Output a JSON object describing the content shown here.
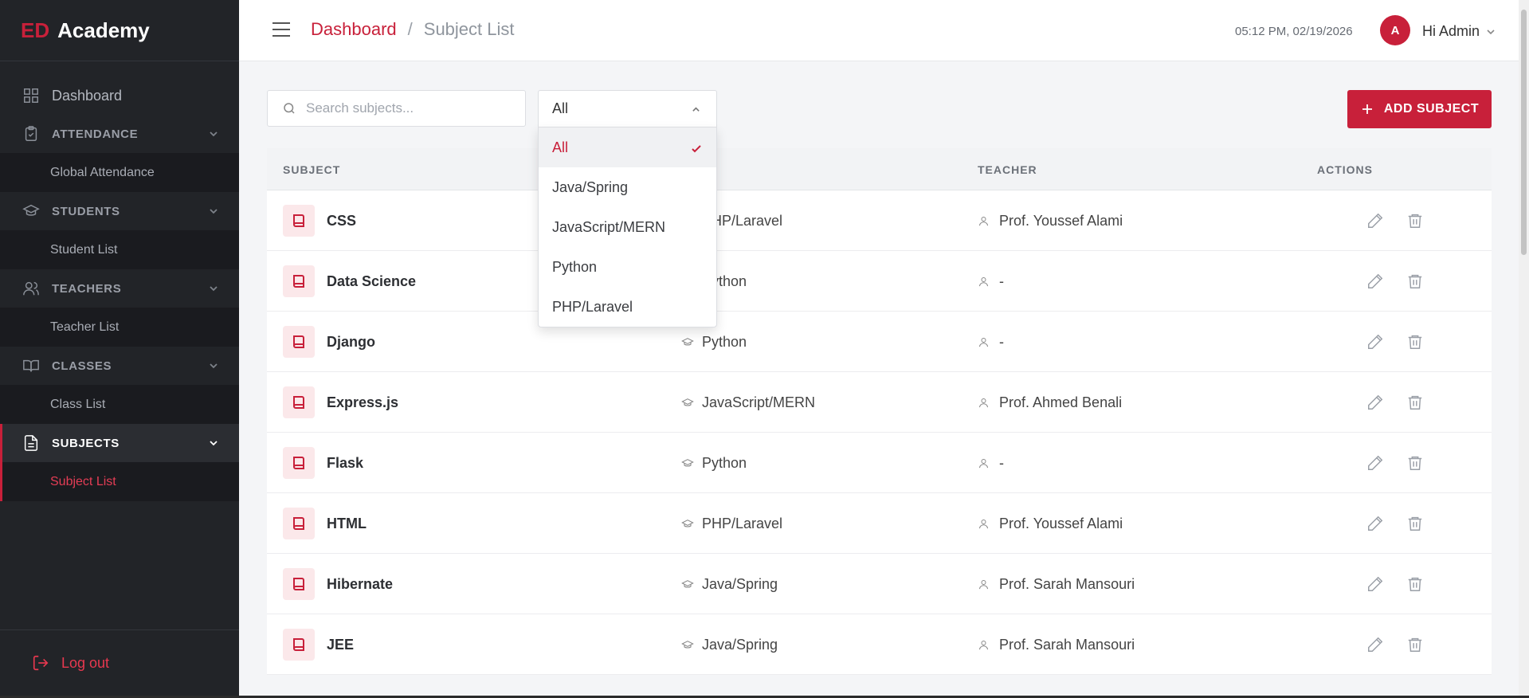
{
  "brand": {
    "part1": "ED",
    "part2": "Academy"
  },
  "sidebar": {
    "dashboard": "Dashboard",
    "attendance": {
      "label": "ATTENDANCE",
      "sub": "Global Attendance"
    },
    "students": {
      "label": "STUDENTS",
      "sub": "Student List"
    },
    "teachers": {
      "label": "TEACHERS",
      "sub": "Teacher List"
    },
    "classes": {
      "label": "CLASSES",
      "sub": "Class List"
    },
    "subjects": {
      "label": "SUBJECTS",
      "sub": "Subject List"
    },
    "logout": "Log out"
  },
  "header": {
    "breadcrumb_root": "Dashboard",
    "breadcrumb_sep": "/",
    "breadcrumb_current": "Subject List",
    "datetime": "05:12 PM, 02/19/2026",
    "avatar_initial": "A",
    "user_greeting": "Hi Admin"
  },
  "toolbar": {
    "search_placeholder": "Search subjects...",
    "filter_value": "All",
    "add_label": "ADD SUBJECT"
  },
  "filter_options": [
    {
      "label": "All",
      "selected": true
    },
    {
      "label": "Java/Spring",
      "selected": false
    },
    {
      "label": "JavaScript/MERN",
      "selected": false
    },
    {
      "label": "Python",
      "selected": false
    },
    {
      "label": "PHP/Laravel",
      "selected": false
    }
  ],
  "table": {
    "headers": {
      "subject": "SUBJECT",
      "teacher": "TEACHER",
      "actions": "ACTIONS"
    },
    "rows": [
      {
        "subject": "CSS",
        "class": "PHP/Laravel",
        "teacher": "Prof. Youssef Alami"
      },
      {
        "subject": "Data Science",
        "class": "Python",
        "teacher": "-"
      },
      {
        "subject": "Django",
        "class": "Python",
        "teacher": "-"
      },
      {
        "subject": "Express.js",
        "class": "JavaScript/MERN",
        "teacher": "Prof. Ahmed Benali"
      },
      {
        "subject": "Flask",
        "class": "Python",
        "teacher": "-"
      },
      {
        "subject": "HTML",
        "class": "PHP/Laravel",
        "teacher": "Prof. Youssef Alami"
      },
      {
        "subject": "Hibernate",
        "class": "Java/Spring",
        "teacher": "Prof. Sarah Mansouri"
      },
      {
        "subject": "JEE",
        "class": "Java/Spring",
        "teacher": "Prof. Sarah Mansouri"
      }
    ]
  },
  "colors": {
    "accent": "#c8203a",
    "sidebar_bg": "#222428",
    "main_bg": "#f4f5f7"
  }
}
